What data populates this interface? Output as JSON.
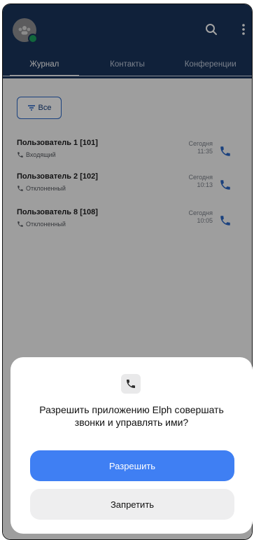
{
  "tabs": [
    "Журнал",
    "Контакты",
    "Конференции"
  ],
  "filter": {
    "label": "Все"
  },
  "calls": [
    {
      "name": "Пользователь 1 [101]",
      "type": "Входящий",
      "day": "Сегодня",
      "time": "11:35"
    },
    {
      "name": "Пользователь 2 [102]",
      "type": "Отклоненный",
      "day": "Сегодня",
      "time": "10:13"
    },
    {
      "name": "Пользователь 8 [108]",
      "type": "Отклоненный",
      "day": "Сегодня",
      "time": "10:05"
    }
  ],
  "dialog": {
    "title": "Разрешить приложению Elph совершать звонки и управлять ими?",
    "allow": "Разрешить",
    "deny": "Запретить"
  },
  "colors": {
    "appbar": "#19345b",
    "accent": "#2a67c6",
    "allow": "#3f7ff3"
  },
  "icons": [
    "avatar-group-icon",
    "search-icon",
    "more-vert-icon",
    "filter-icon",
    "phone-icon"
  ]
}
